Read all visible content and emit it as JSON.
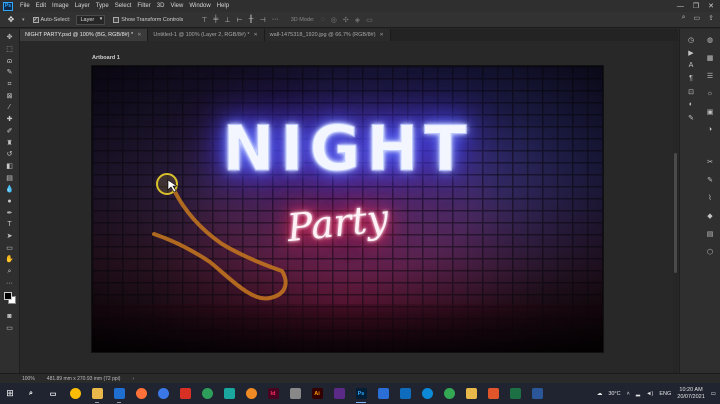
{
  "app": {
    "logo_text": "Ps",
    "menu": [
      "File",
      "Edit",
      "Image",
      "Layer",
      "Type",
      "Select",
      "Filter",
      "3D",
      "View",
      "Window",
      "Help"
    ],
    "window_controls": [
      "—",
      "❐",
      "✕"
    ]
  },
  "options_bar": {
    "tool_icon": "move-icon",
    "auto_select_label": "Auto-Select:",
    "auto_select_checked": true,
    "auto_select_target": "Layer",
    "show_transform_label": "Show Transform Controls",
    "show_transform_checked": false,
    "mode_3d_label": "3D Mode:"
  },
  "tabs": [
    {
      "label": "NIGHT PARTY.psd @ 100% (BG, RGB/8#) *",
      "active": true
    },
    {
      "label": "Untitled-1 @ 100% (Layer 2, RGB/8#) *",
      "active": false
    },
    {
      "label": "wall-1475318_1920.jpg @ 66.7% (RGB/8#)",
      "active": false
    }
  ],
  "canvas": {
    "artboard_label": "Artboard 1",
    "title_text": "NIGHT",
    "subtitle_text": "Party"
  },
  "status": {
    "zoom": "100%",
    "doc_info": "481.89 mm x 270.93 mm (72 ppi)"
  },
  "tray": {
    "temperature": "30°C",
    "language": "ENG",
    "time": "10:20 AM",
    "date": "20/07/2021"
  },
  "colors": {
    "accent": "#31a8ff",
    "stroke_orange": "#c8781e",
    "marker_yellow": "#d9c12a"
  }
}
